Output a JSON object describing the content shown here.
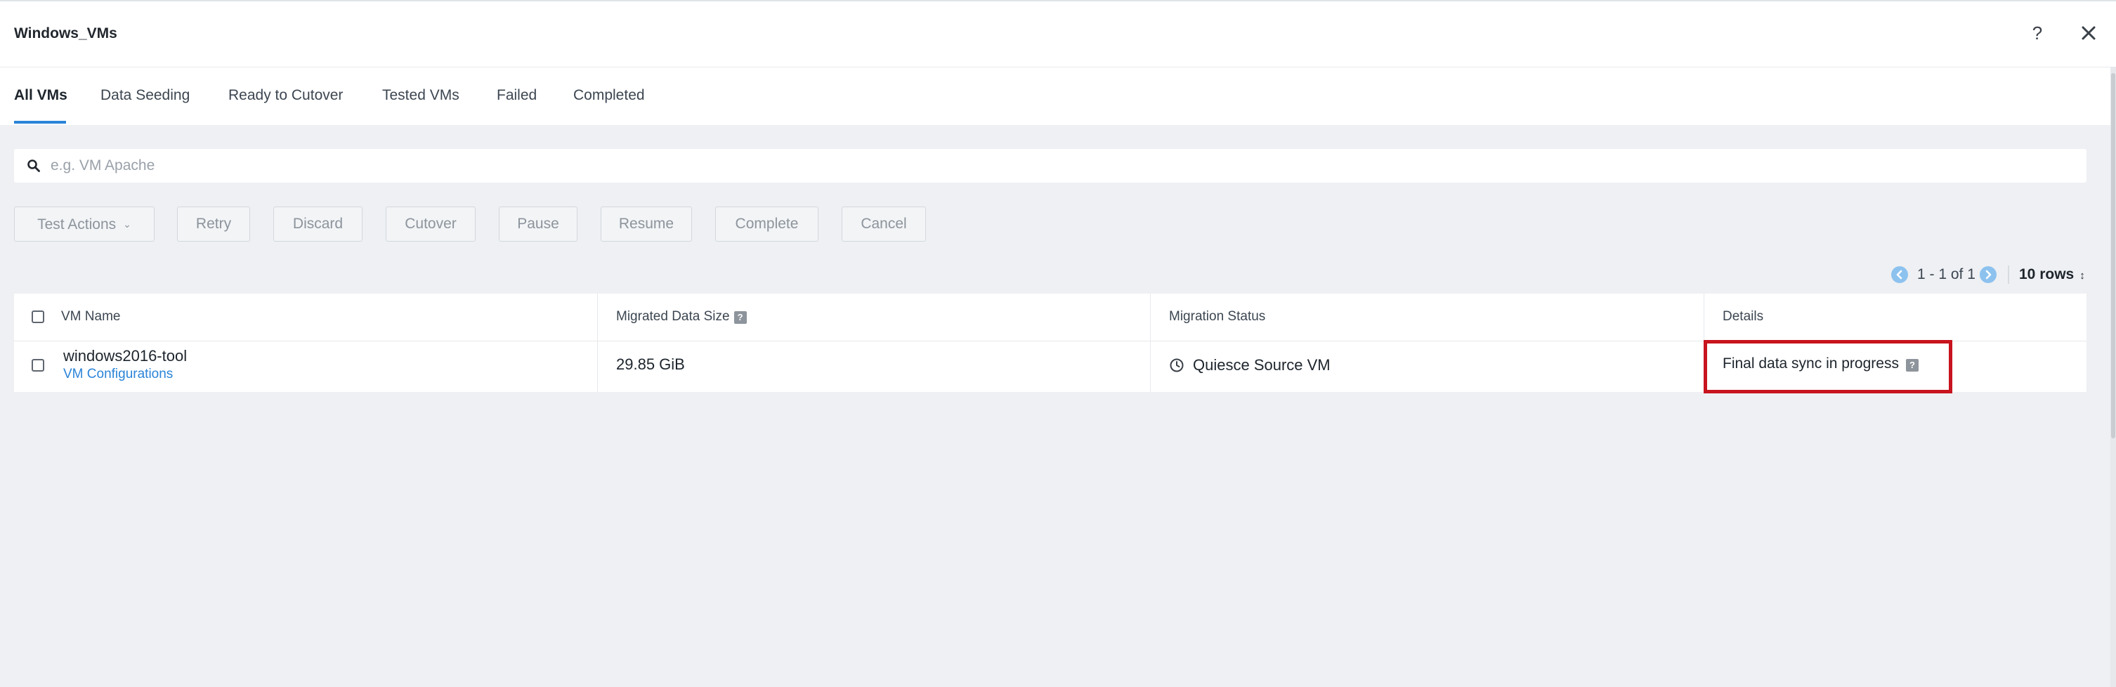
{
  "header": {
    "title": "Windows_VMs",
    "help_label": "?"
  },
  "tabs": [
    {
      "label": "All VMs",
      "active": true
    },
    {
      "label": "Data Seeding",
      "active": false
    },
    {
      "label": "Ready to Cutover",
      "active": false
    },
    {
      "label": "Tested VMs",
      "active": false
    },
    {
      "label": "Failed",
      "active": false
    },
    {
      "label": "Completed",
      "active": false
    }
  ],
  "search": {
    "placeholder": "e.g. VM Apache",
    "value": ""
  },
  "toolbar": {
    "test_actions": "Test Actions",
    "retry": "Retry",
    "discard": "Discard",
    "cutover": "Cutover",
    "pause": "Pause",
    "resume": "Resume",
    "complete": "Complete",
    "cancel": "Cancel"
  },
  "pagination": {
    "range": "1 - 1 of 1",
    "rows": "10 rows"
  },
  "table": {
    "columns": {
      "vm_name": "VM Name",
      "migrated_size": "Migrated Data Size",
      "status": "Migration Status",
      "details": "Details"
    },
    "rows": [
      {
        "vm_name": "windows2016-tool",
        "config_link": "VM Configurations",
        "migrated_size": "29.85 GiB",
        "status": "Quiesce Source VM",
        "details": "Final data sync in progress"
      }
    ]
  },
  "colors": {
    "accent": "#2b84d8",
    "highlight": "#c8141e",
    "background": "#eef0f3"
  },
  "icons": {
    "info": "?"
  }
}
